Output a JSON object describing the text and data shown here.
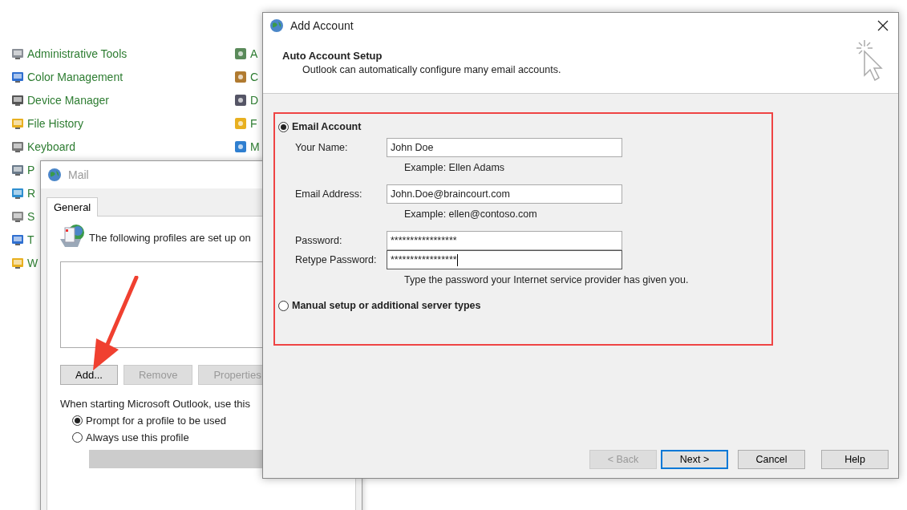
{
  "control_panel": {
    "column_1": [
      {
        "label": "Administrative Tools"
      },
      {
        "label": "Color Management"
      },
      {
        "label": "Device Manager"
      },
      {
        "label": "File History"
      },
      {
        "label": "Keyboard"
      },
      {
        "label": "P"
      },
      {
        "label": "R"
      },
      {
        "label": "S"
      },
      {
        "label": "T"
      },
      {
        "label": "W"
      }
    ],
    "column_2": [
      {
        "label": "A"
      },
      {
        "label": "C"
      },
      {
        "label": "D"
      },
      {
        "label": "F"
      },
      {
        "label": "M"
      }
    ]
  },
  "mail_window": {
    "title": "Mail",
    "tabs": [
      {
        "label": "General",
        "selected": true
      }
    ],
    "intro": "The following profiles are set up on",
    "buttons": [
      {
        "label": "Add...",
        "disabled": false
      },
      {
        "label": "Remove",
        "disabled": true
      },
      {
        "label": "Properties",
        "disabled": true
      }
    ],
    "startup_label": "When starting Microsoft Outlook, use this",
    "options": [
      {
        "label": "Prompt for a profile to be used",
        "selected": true
      },
      {
        "label": "Always use this profile",
        "selected": false
      }
    ]
  },
  "add_account": {
    "title": "Add Account",
    "heading": "Auto Account Setup",
    "subheading": "Outlook can automatically configure many email accounts.",
    "options": [
      {
        "label": "Email Account",
        "selected": true
      },
      {
        "label": "Manual setup or additional server types",
        "selected": false
      }
    ],
    "fields": [
      {
        "label": "Your Name:",
        "value": "John Doe",
        "focused": false,
        "hint": "Example: Ellen Adams"
      },
      {
        "label": "Email Address:",
        "value": "John.Doe@braincourt.com",
        "focused": false,
        "hint": "Example: ellen@contoso.com"
      },
      {
        "label": "Password:",
        "value": "*****************",
        "focused": false
      },
      {
        "label": "Retype Password:",
        "value": "*****************",
        "focused": true,
        "hint": "Type the password your Internet service provider has given you."
      }
    ],
    "buttons": [
      {
        "label": "< Back",
        "disabled": true,
        "default": false
      },
      {
        "label": "Next >",
        "disabled": false,
        "default": true
      },
      {
        "label": "Cancel",
        "disabled": false,
        "default": false
      },
      {
        "label": "Help",
        "disabled": false,
        "default": false
      }
    ]
  }
}
